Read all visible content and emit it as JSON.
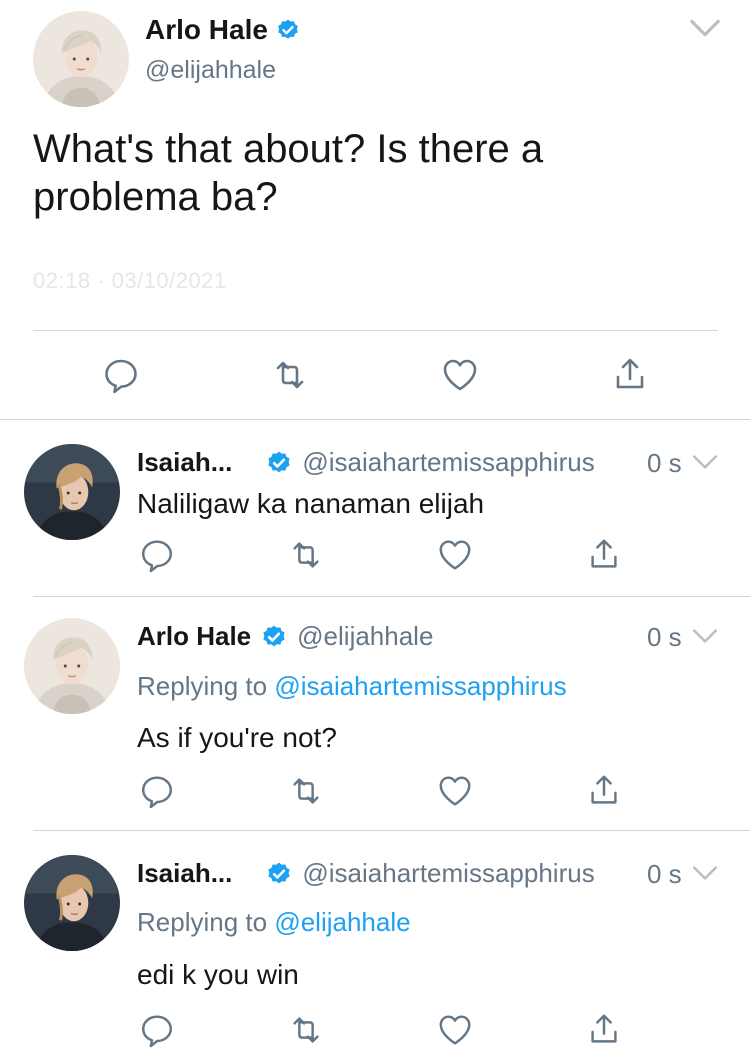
{
  "main_tweet": {
    "name": "Arlo Hale",
    "handle": "@elijahhale",
    "text": "What's that about? Is there a problema ba?",
    "timestamp": "02:18 · 03/10/2021",
    "verified_icon": "verified-badge-icon"
  },
  "replies": [
    {
      "name": "Isaiah...",
      "handle": "@isaiahartemissapphirus",
      "time": "0 s",
      "replying_prefix": "",
      "replying_to": "",
      "text": "Naliligaw ka nanaman elijah"
    },
    {
      "name": "Arlo Hale",
      "handle": "@elijahhale",
      "time": "0 s",
      "replying_prefix": "Replying to",
      "replying_to": "@isaiahartemissapphirus",
      "text": "As if you're not?"
    },
    {
      "name": "Isaiah...",
      "handle": "@isaiahartemissapphirus",
      "time": "0 s",
      "replying_prefix": "Replying to",
      "replying_to": "@elijahhale",
      "text": "edi k you win"
    }
  ],
  "action_icons": [
    "reply-icon",
    "retweet-icon",
    "like-icon",
    "share-icon"
  ],
  "colors": {
    "text": "#14171a",
    "muted": "#657786",
    "link": "#1da1f2",
    "verified": "#1da1f2",
    "icon": "#657786"
  }
}
